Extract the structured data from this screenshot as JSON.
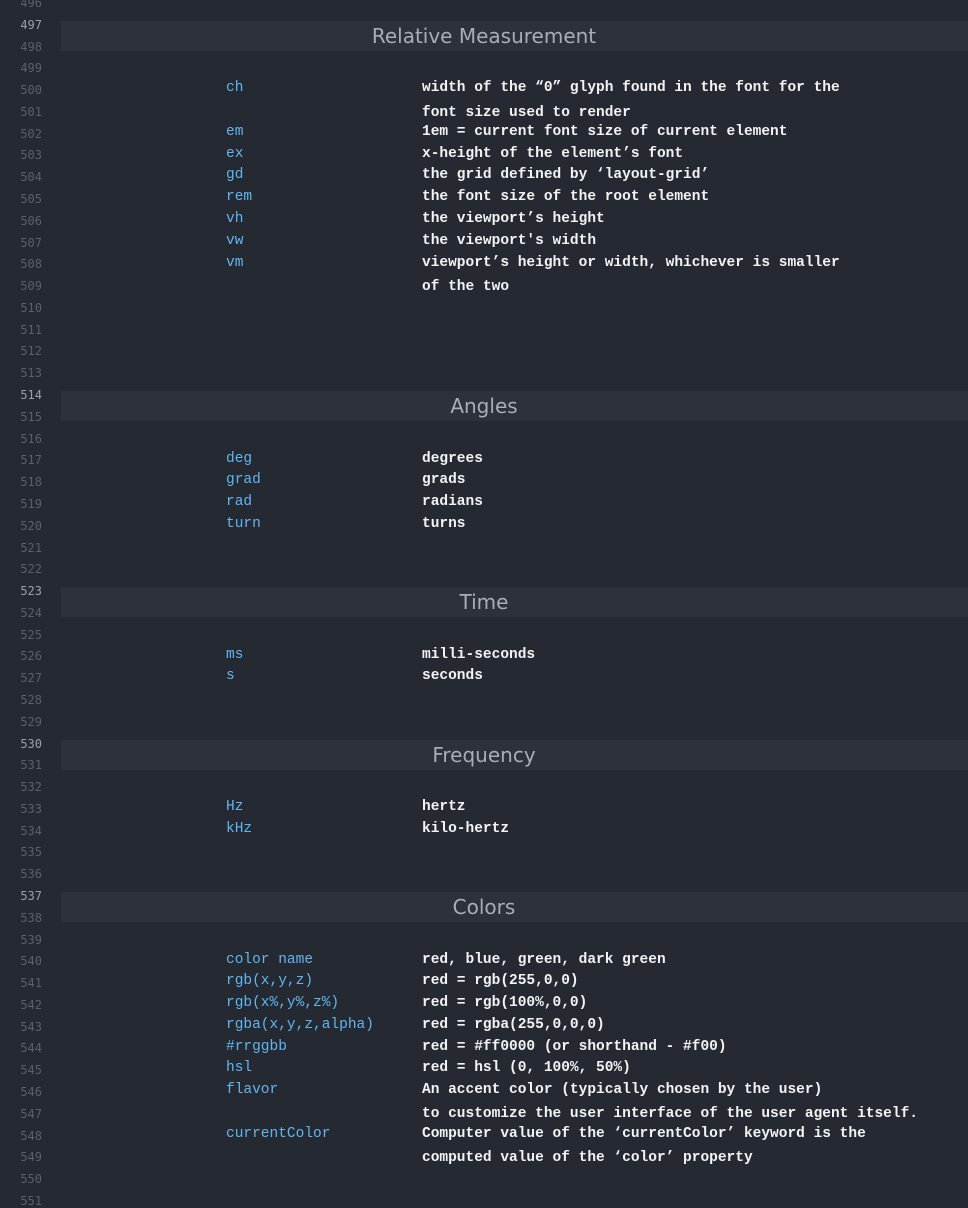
{
  "gutter": {
    "first_line": 496,
    "lines": [
      "496",
      "497",
      "498",
      "499",
      "500",
      "501",
      "502",
      "503",
      "504",
      "505",
      "506",
      "507",
      "508",
      "509",
      "510",
      "511",
      "512",
      "513",
      "514",
      "515",
      "516",
      "517",
      "518",
      "519",
      "520",
      "521",
      "522",
      "523",
      "524",
      "525",
      "526",
      "527",
      "528",
      "529",
      "530",
      "531",
      "532",
      "533",
      "534",
      "535",
      "536",
      "537",
      "538",
      "539",
      "540",
      "541",
      "542",
      "543",
      "544",
      "545",
      "546",
      "547",
      "548",
      "549",
      "550",
      "551"
    ],
    "highlighted": [
      "497",
      "514",
      "523",
      "530",
      "537"
    ]
  },
  "sections": [
    {
      "heading": "Relative Measurement",
      "rows": [
        {
          "term": "ch",
          "desc": [
            "width of the “0” glyph found in the font for the",
            "font size used to render"
          ]
        },
        {
          "term": "em",
          "desc": [
            "1em = current font size of current element"
          ]
        },
        {
          "term": "ex",
          "desc": [
            "x-height of the element’s font"
          ]
        },
        {
          "term": "gd",
          "desc": [
            "the grid defined by ‘layout-grid’"
          ]
        },
        {
          "term": "rem",
          "desc": [
            "the font size of the root element"
          ]
        },
        {
          "term": "vh",
          "desc": [
            "the viewport’s height"
          ]
        },
        {
          "term": "vw",
          "desc": [
            "the viewport's width"
          ]
        },
        {
          "term": "vm",
          "desc": [
            "viewport’s height or width, whichever is smaller",
            "of the two"
          ]
        }
      ]
    },
    {
      "heading": "Angles",
      "rows": [
        {
          "term": "deg",
          "desc": [
            "degrees"
          ]
        },
        {
          "term": "grad",
          "desc": [
            "grads"
          ]
        },
        {
          "term": "rad",
          "desc": [
            "radians"
          ]
        },
        {
          "term": "turn",
          "desc": [
            "turns"
          ]
        }
      ]
    },
    {
      "heading": "Time",
      "rows": [
        {
          "term": "ms",
          "desc": [
            "milli-seconds"
          ]
        },
        {
          "term": "s",
          "desc": [
            "seconds"
          ]
        }
      ]
    },
    {
      "heading": "Frequency",
      "rows": [
        {
          "term": "Hz",
          "desc": [
            "hertz"
          ]
        },
        {
          "term": "kHz",
          "desc": [
            "kilo-hertz"
          ]
        }
      ]
    },
    {
      "heading": "Colors",
      "rows": [
        {
          "term": "color name",
          "desc": [
            "red, blue, green, dark green"
          ]
        },
        {
          "term": "rgb(x,y,z)",
          "desc": [
            "red = rgb(255,0,0)"
          ]
        },
        {
          "term": "rgb(x%,y%,z%)",
          "desc": [
            "red = rgb(100%,0,0)"
          ]
        },
        {
          "term": "rgba(x,y,z,alpha)",
          "desc": [
            "red = rgba(255,0,0,0)"
          ]
        },
        {
          "term": "#rrggbb",
          "desc": [
            "red = #ff0000 (or shorthand - #f00)"
          ]
        },
        {
          "term": "hsl",
          "desc": [
            "red = hsl (0, 100%, 50%)"
          ]
        },
        {
          "term": "flavor",
          "desc": [
            "An accent color (typically chosen by the user)",
            "to customize the user interface of the user agent itself."
          ]
        },
        {
          "term": "currentColor",
          "desc": [
            "Computer value of the ‘currentColor’ keyword is the",
            "computed value of the ‘color’ property"
          ]
        }
      ]
    }
  ],
  "colors": {
    "background": "#252931",
    "heading_band": "#2d313a",
    "term": "#62b6f0",
    "desc": "#f2f3f5",
    "line_number": "#5a606b",
    "line_number_active": "#9aa0aa"
  }
}
